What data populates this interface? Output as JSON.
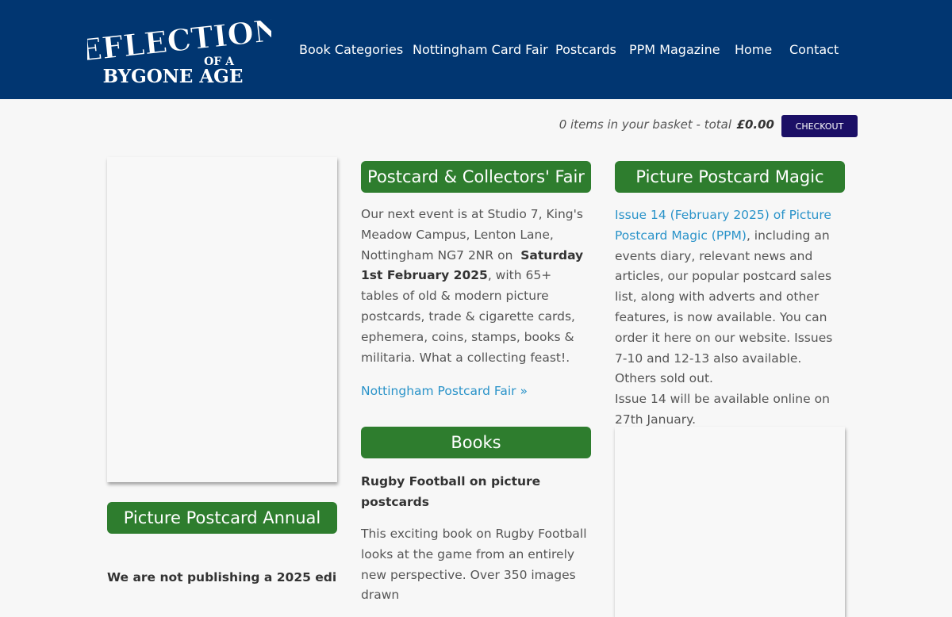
{
  "header": {
    "logo": {
      "line1": "REFLECTIONS",
      "line2": "OF A",
      "line3": "BYGONE AGE"
    },
    "nav": [
      {
        "label": "Book Categories"
      },
      {
        "label": "Nottingham Card Fair"
      },
      {
        "label": "Postcards"
      },
      {
        "label": "PPM Magazine"
      },
      {
        "label": "Home"
      },
      {
        "label": "Contact"
      }
    ]
  },
  "basket": {
    "summary": "0 items in your basket - total",
    "total": "£0.00",
    "checkout_label": "Checkout"
  },
  "fair": {
    "title": "Postcard & Collectors' Fair",
    "text_before": "Our next event is at Studio 7, King's Meadow Campus, Lenton Lane, Nottingham NG7 2NR on",
    "date": "Saturday 1st February 2025",
    "text_after": ", with 65+ tables of old & modern picture postcards, trade & cigarette cards, ephemera, coins, stamps, books & militaria. What a collecting feast!.",
    "link": "Nottingham Postcard Fair »"
  },
  "books": {
    "title": "Books",
    "book_title": "Rugby Football on picture postcards",
    "description": "This exciting book on Rugby Football looks at the game from an entirely new perspective. Over 350 images drawn"
  },
  "ppm": {
    "title": "Picture Postcard Magic",
    "link": "Issue 14 (February 2025) of Picture Postcard Magic (PPM)",
    "text": ", including an events diary, relevant news and articles, our popular postcard sales list, along with adverts and other features, is now available. You can order it here on our website. Issues 7-10 and 12-13 also available. Others sold out.",
    "note": "Issue 14 will be available online on 27th January."
  },
  "annual": {
    "title": "Picture Postcard Annual",
    "text": "We are not publishing a 2025 edi-"
  }
}
